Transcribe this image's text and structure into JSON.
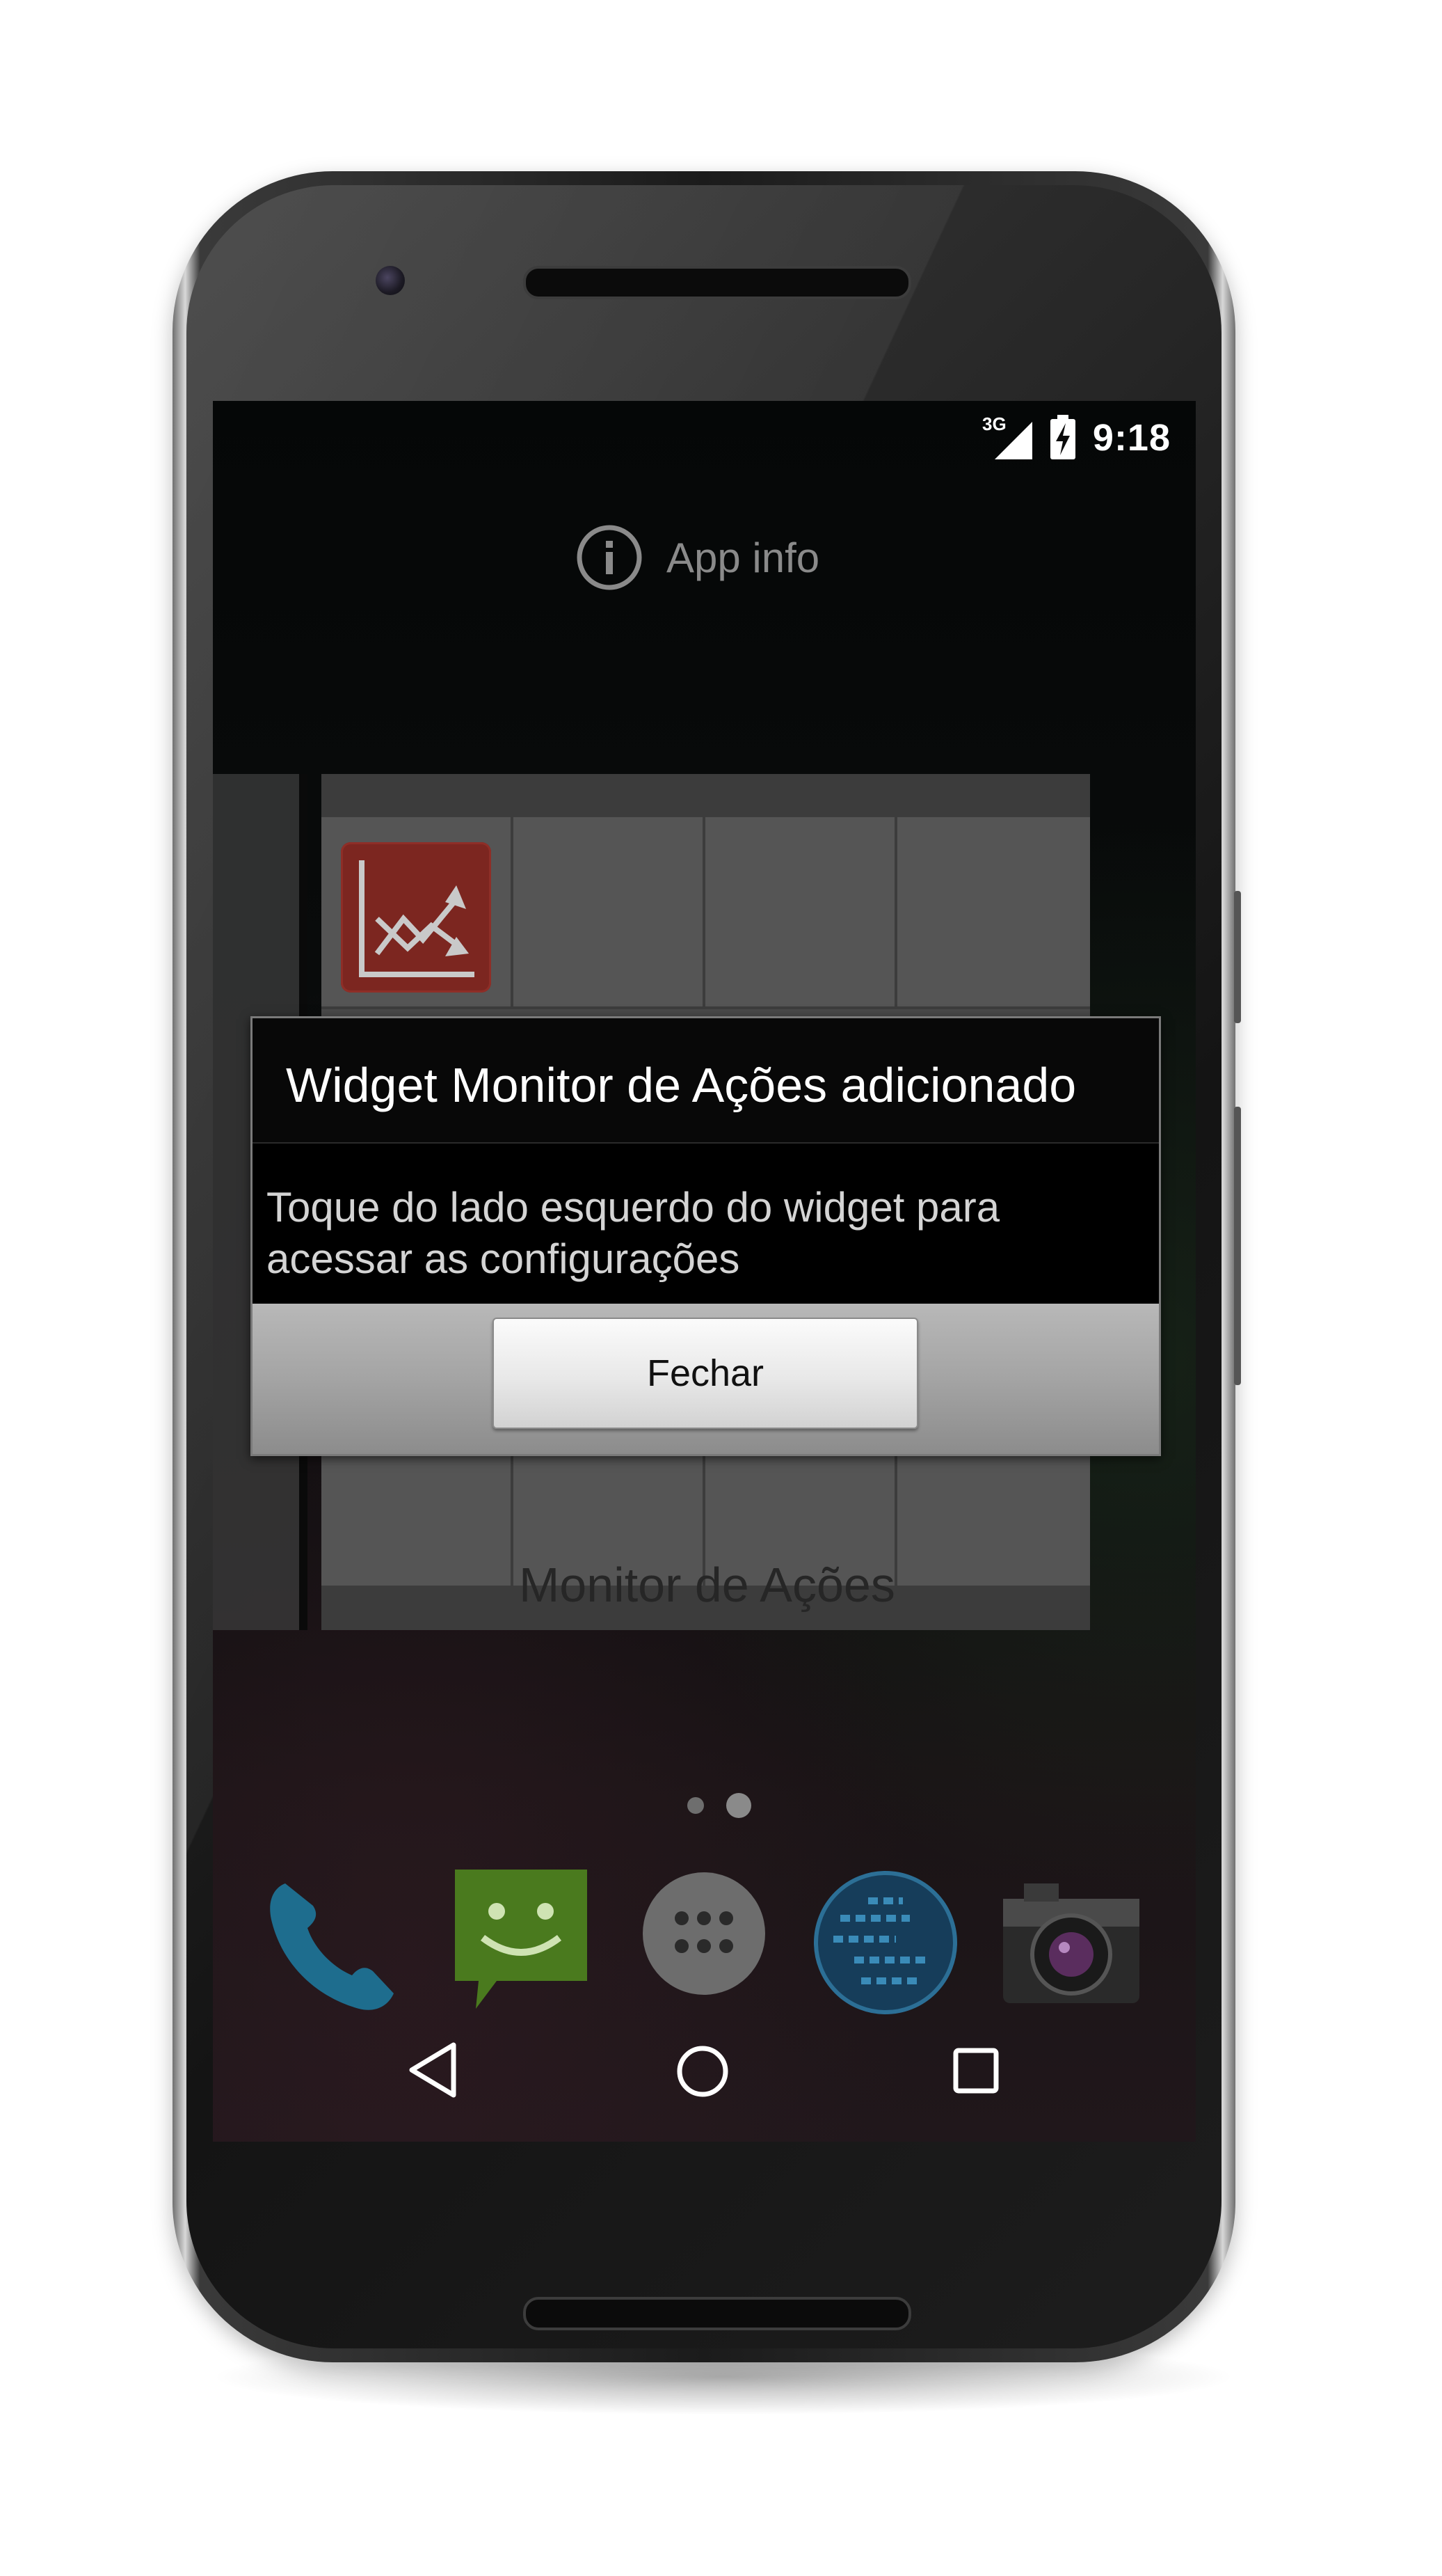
{
  "status_bar": {
    "network": "3G",
    "time": "9:18"
  },
  "drag_target": {
    "label": "App info",
    "icon": "info-icon"
  },
  "widget_preview": {
    "icon": "stock-chart-icon",
    "ghost_label": "Monitor de Ações"
  },
  "dialog": {
    "title": "Widget Monitor de Ações adicionado",
    "message": "Toque do lado esquerdo do widget para acessar as configurações",
    "button_label": "Fechar"
  },
  "home": {
    "active_page": 2,
    "page_count": 2,
    "dock": [
      {
        "icon": "phone-icon"
      },
      {
        "icon": "messaging-icon"
      },
      {
        "icon": "app-drawer-icon"
      },
      {
        "icon": "browser-globe-icon"
      },
      {
        "icon": "camera-icon"
      }
    ]
  },
  "navigation": {
    "back": "back-icon",
    "home": "home-icon",
    "recents": "recents-icon"
  },
  "colors": {
    "widget_icon_bg": "#7c2620",
    "dialog_bg": "#000000",
    "button_bar": "#a4a4a4"
  }
}
